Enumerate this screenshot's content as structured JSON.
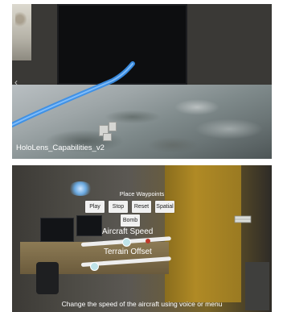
{
  "top": {
    "caption": "HoloLens_Capabilities_v2",
    "colors": {
      "flight_path": "#3a8fe8",
      "tv": "#0d0e10",
      "terrain": "#9ea6a8"
    }
  },
  "bottom": {
    "menu_title": "Place Waypoints",
    "buttons": {
      "play": "Play",
      "stop": "Stop",
      "reset": "Reset",
      "spatial": "Spatial",
      "bomb": "Bomb"
    },
    "sliders": {
      "aircraft_speed": {
        "label": "Aircraft Speed",
        "value": 0.5
      },
      "terrain_offset": {
        "label": "Terrain Offset",
        "value": 0.15
      }
    },
    "caption": "Change the speed of the aircraft using voice or menu",
    "colors": {
      "button_bg": "#f1f1f1",
      "thumb": "#bfe3e8",
      "door": "#b08a25"
    }
  }
}
